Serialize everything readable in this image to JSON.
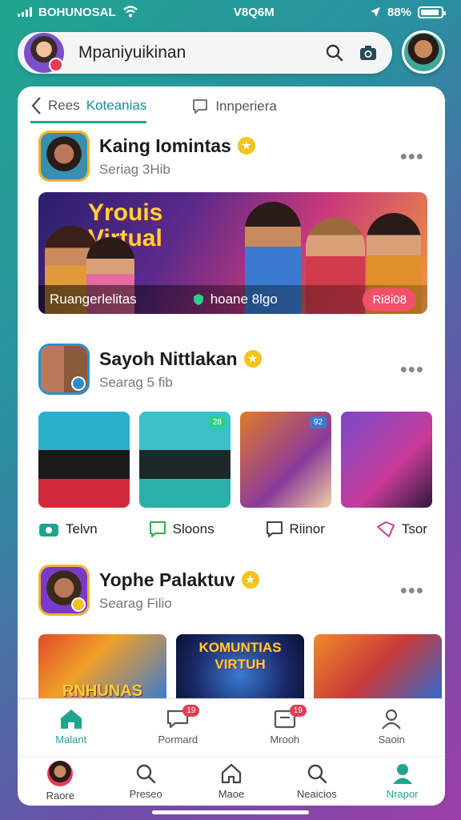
{
  "status": {
    "carrier": "BOHUNOSAL",
    "time": "V8Q6M",
    "battery": "88%"
  },
  "search": {
    "placeholder": "Mpaniyuikinan"
  },
  "tabs": [
    {
      "label_a": "Rees",
      "label_b": "Koteanias"
    },
    {
      "label": "Innperiera"
    }
  ],
  "communities": [
    {
      "title": "Kaing Iomintas",
      "subtitle": "Seriag 3Hib",
      "banner": {
        "title_line1": "Yrouis",
        "title_line2": "Virtual",
        "footer_left": "Ruangerlelitas",
        "footer_mid": "hoane 8lgo",
        "button": "Ri8i08"
      }
    },
    {
      "title": "Sayoh Nittlakan",
      "subtitle": "Searag 5 fib",
      "thumb_tags": [
        "28",
        "92"
      ],
      "actions": [
        "Telvn",
        "Sloons",
        "Riinor",
        "Tsor"
      ]
    },
    {
      "title": "Yophe Palaktuv",
      "subtitle": "Searag Filio",
      "thumb_texts": [
        "RNHUNAS",
        "KOMUNTIAS VIRTUH",
        ""
      ]
    }
  ],
  "tabbar": [
    {
      "label": "Malant",
      "badge": ""
    },
    {
      "label": "Pormard",
      "badge": "19"
    },
    {
      "label": "Mrooh",
      "badge": "19"
    },
    {
      "label": "Saoin",
      "badge": ""
    }
  ],
  "navbar": [
    {
      "label": "Raore"
    },
    {
      "label": "Preseo"
    },
    {
      "label": "Maoe"
    },
    {
      "label": "Neaicios"
    },
    {
      "label": "Nrapor"
    }
  ],
  "colors": {
    "accent": "#1fa58f",
    "badge": "#f4c21a",
    "notification": "#e53b55"
  }
}
